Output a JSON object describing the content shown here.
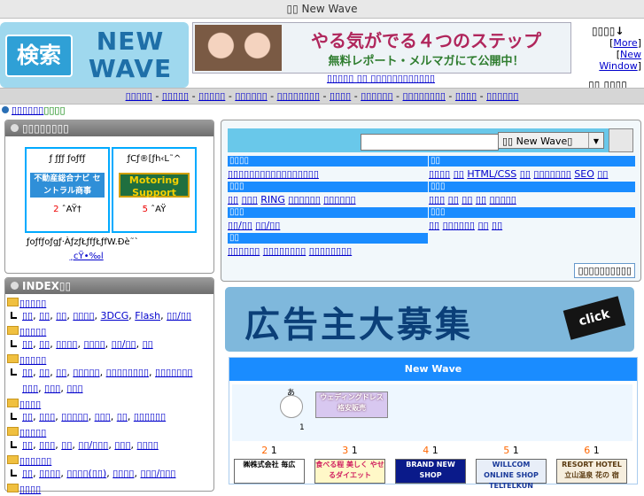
{
  "top_title": "▯▯ New Wave",
  "logo": {
    "mark": "検索",
    "line1": "NEW",
    "line2": "WAVE"
  },
  "banner": {
    "line1": "やる気がでる４つのステップ",
    "line2": "無料レポート・メルマガにて公開中！"
  },
  "banner_links": {
    "a": "▯▯▯▯▯ ▯▯ ▯▯",
    "b": "▯▯▯▯▯▯▯▯▯▯"
  },
  "right_box": {
    "title": "▯▯▯▯↓",
    "more_open": "[",
    "more": "More",
    "more_close": "]",
    "new_window_open": "[",
    "new_window": "New Window",
    "new_window_close": "]",
    "bottom": "▯▯ ▯▯▯▯"
  },
  "nav": [
    "▯▯▯▯▯",
    "▯▯▯▯▯",
    "▯▯▯▯▯",
    "▯▯▯▯▯▯",
    "▯▯▯▯▯▯▯▯",
    "▯▯▯▯",
    "▯▯▯▯▯▯",
    "▯▯▯▯▯▯▯▯",
    "▯▯▯▯",
    "▯▯▯▯▯▯"
  ],
  "nav_sep": " - ",
  "crumb": {
    "link": "▯▯▯▯▯▯",
    "green": "▯▯▯▯"
  },
  "featured": {
    "title": "▯▯▯▯▯▯▯▯",
    "cells": [
      {
        "label": "ƒ ƒƒƒ ƒoƒfƒ",
        "img_text": "不動産総合ナビ セントラル商事",
        "rank_num": "2",
        "rank_text": " ˆAŸ†"
      },
      {
        "label": "ƒCƒ®[ƒh‹L˜^",
        "img_text": "Motoring Support",
        "rank_num": "5",
        "rank_text": " ˆAŸ"
      }
    ],
    "footer1": "ƒoƒfƒoƒgƒ·ÀƒzƒŁƒfƒŁƒfW.Ðè˜`",
    "footer2": "¸cŸ•‰l"
  },
  "index": {
    "title": "INDEX▯▯",
    "categories": [
      {
        "name": "▯▯▯▯▯",
        "subs": [
          "▯▯",
          "▯▯",
          "▯▯",
          "▯▯▯▯",
          "3DCG",
          "Flash",
          "▯▯/▯▯"
        ]
      },
      {
        "name": "▯▯▯▯▯",
        "subs": [
          "▯▯",
          "▯▯",
          "▯▯▯▯",
          "▯▯▯▯",
          "▯▯/▯▯",
          "▯▯"
        ]
      },
      {
        "name": "▯▯▯▯▯",
        "subs": [
          "▯▯",
          "▯▯",
          "▯▯",
          "▯▯▯▯▯",
          "▯▯▯▯▯▯▯▯",
          "▯▯▯▯▯▯▯"
        ]
      },
      {
        "name": "",
        "subs": [
          "▯▯▯",
          "▯▯▯",
          "▯▯▯"
        ]
      },
      {
        "name": "▯▯▯▯",
        "subs": [
          "▯▯",
          "▯▯▯",
          "▯▯▯▯▯",
          "▯▯▯",
          "▯▯",
          "▯▯▯▯▯▯"
        ]
      },
      {
        "name": "▯▯▯▯▯",
        "subs": [
          "▯▯",
          "▯▯▯",
          "▯▯",
          "▯▯/▯▯▯",
          "▯▯▯",
          "▯▯▯▯"
        ]
      },
      {
        "name": "▯▯▯▯▯▯",
        "subs": [
          "▯▯",
          "▯▯▯▯",
          "▯▯▯▯(▯▯)",
          "▯▯▯▯",
          "▯▯▯/▯▯▯"
        ]
      },
      {
        "name": "▯▯▯▯",
        "subs": []
      }
    ]
  },
  "search": {
    "placeholder": "",
    "select_value": "▯▯ New Wave▯",
    "submit": ""
  },
  "directory": {
    "left": [
      {
        "head": "▯▯▯▯",
        "items": [
          "▯▯▯▯▯▯▯▯▯▯▯▯▯▯▯▯▯"
        ]
      },
      {
        "head": "▯▯▯",
        "items": [
          "▯▯",
          "▯▯▯",
          "RING",
          "▯▯▯▯▯▯",
          "▯▯▯▯▯▯"
        ]
      },
      {
        "head": "▯▯▯",
        "items": [
          "▯▯/▯▯",
          "▯▯/▯▯"
        ]
      },
      {
        "head": "▯▯",
        "items": [
          "▯▯▯▯▯▯",
          "▯▯▯▯▯▯▯▯",
          "▯▯▯▯▯▯▯▯"
        ]
      }
    ],
    "right": [
      {
        "head": "▯▯",
        "items": [
          "▯▯▯▯",
          "▯▯",
          "HTML/CSS",
          "▯▯",
          "▯▯▯▯▯▯▯",
          "SEO",
          "▯▯"
        ]
      },
      {
        "head": "▯▯▯",
        "items": [
          "▯▯▯",
          "▯▯",
          "▯▯",
          "▯▯",
          "▯▯▯▯▯"
        ]
      },
      {
        "head": "▯▯▯",
        "items": [
          "▯▯",
          "▯▯▯▯▯▯",
          "▯▯",
          "▯▯"
        ]
      }
    ],
    "more_button": "▯▯▯▯▯▯▯▯▯▯"
  },
  "ad_banner": {
    "text": "広告主大募集",
    "click": "click"
  },
  "new_wave": {
    "title": "New Wave",
    "mascot_label": "あ",
    "mascot_count": "1",
    "dress_text": "ウェディングドレス 格安販売",
    "ranks": [
      {
        "num": "2",
        "count": " 1",
        "img_text": "㈱株式会社 毎広"
      },
      {
        "num": "3",
        "count": " 1",
        "img_text": "食べる程 美しく やせるダイエット"
      },
      {
        "num": "4",
        "count": " 1",
        "img_text": "BRAND NEW SHOP"
      },
      {
        "num": "5",
        "count": " 1",
        "img_text": "WILLCOM ONLINE SHOP TELTELKUN"
      },
      {
        "num": "6",
        "count": " 1",
        "img_text": "RESORT HOTEL 立山温泉 花の 宿"
      }
    ]
  },
  "colors": {
    "accent_blue": "#1a8cff",
    "search_bar": "#69c8ea",
    "link": "#0000cc",
    "rank_orange": "#ff6600",
    "nav_bg": "#d6d6d6"
  }
}
